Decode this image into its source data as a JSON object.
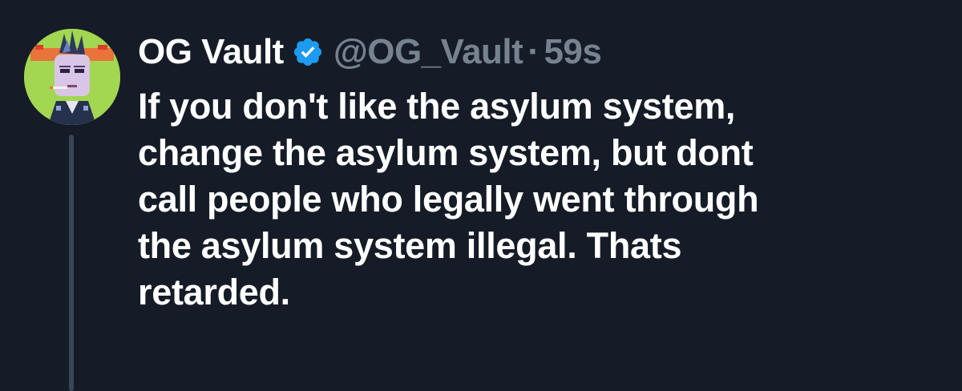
{
  "tweet": {
    "author": {
      "display_name": "OG Vault",
      "handle": "@OG_Vault",
      "verified": true,
      "avatar_icon": "pixel-art-character-avatar"
    },
    "separator": "·",
    "timestamp": "59s",
    "text_lines": [
      "If you don't like the asylum system,",
      "change the asylum system, but dont",
      "call people who legally went through",
      "the asylum system illegal. Thats",
      "retarded."
    ]
  },
  "colors": {
    "background": "#151c27",
    "text_primary": "#ffffff",
    "text_secondary": "#76838f",
    "verified_badge": "#1d9bf0",
    "thread_line": "#3a4654"
  }
}
